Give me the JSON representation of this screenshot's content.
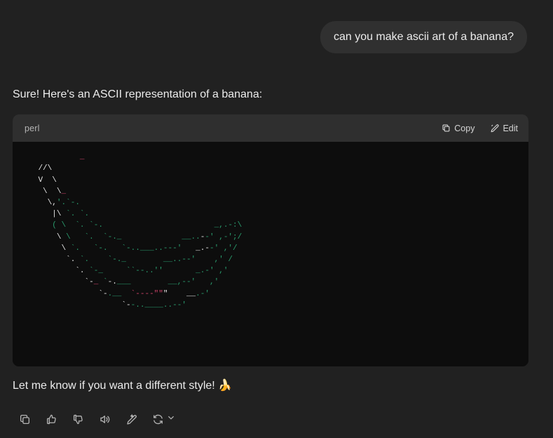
{
  "theme": {
    "page_bg": "#212121",
    "user_bubble_bg": "#303030",
    "code_header_bg": "#2f2f2f",
    "code_body_bg": "#0d0d0d",
    "text_color": "#ececec",
    "ascii_green": "#2a9d6e",
    "ascii_white": "#e8e8e8",
    "ascii_pink": "#d1436a",
    "ascii_yellow": "#d8a13a"
  },
  "user": {
    "message": "can you make ascii art of a banana?"
  },
  "assistant": {
    "intro": "Sure! Here's an ASCII representation of a banana:",
    "outro": "Let me know if you want a different style! 🍌"
  },
  "code_block": {
    "language": "perl",
    "copy_label": "Copy",
    "edit_label": "Edit",
    "copy_icon": "copy-icon",
    "edit_icon": "pencil-icon",
    "ascii_art_lines": [
      "             _",
      "    //\\",
      "    V  \\",
      "     \\  \\_",
      "      \\,'.`-.",
      "       |\\ `. `.",
      "       ( \\  `. `-.                        _,.-:\\",
      "        \\ \\   `.  `-._             __..--' ,-';/",
      "         \\ `.   `-.   `-..___..---'   _.--' ,'/",
      "          `. `.    `-._        __..--'    ,' /",
      "            `. `-_     ``--..''       _.-' ,'",
      "              `-_ `-.___        __,--'   ,'",
      "                 `-.__  `----\"\"\"    __.-'",
      "                      `--..____..--'"
    ]
  },
  "action_bar": {
    "buttons": [
      {
        "name": "copy-icon",
        "label": "Copy"
      },
      {
        "name": "thumbs-up-icon",
        "label": "Good response"
      },
      {
        "name": "thumbs-down-icon",
        "label": "Bad response"
      },
      {
        "name": "speaker-icon",
        "label": "Read aloud"
      },
      {
        "name": "edit-sparkle-icon",
        "label": "Edit in canvas"
      },
      {
        "name": "regenerate-icon",
        "label": "Regenerate"
      },
      {
        "name": "chevron-down-icon",
        "label": "More"
      }
    ]
  }
}
